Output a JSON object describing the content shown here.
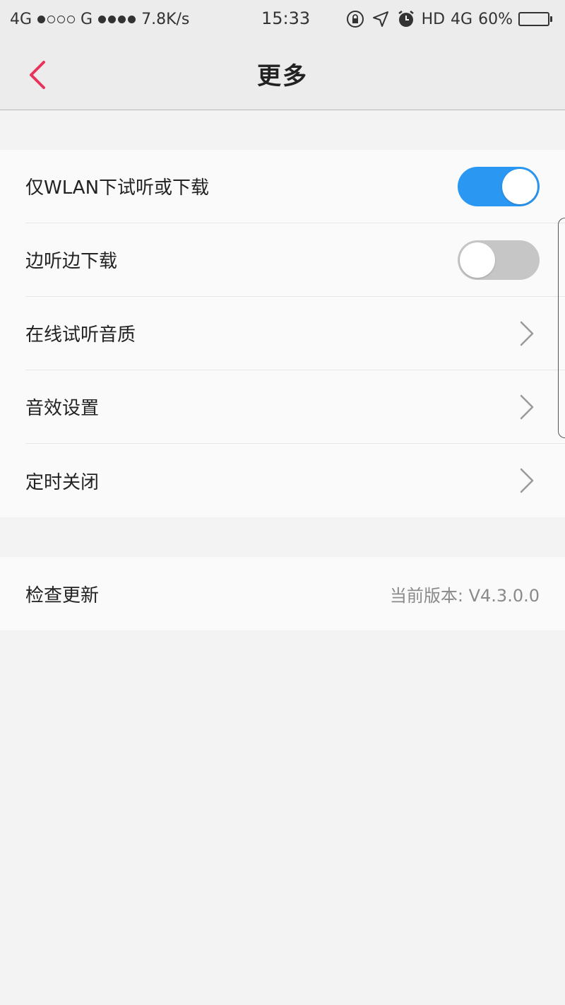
{
  "status_bar": {
    "network1": "4G",
    "network2": "G",
    "speed": "7.8K/s",
    "time": "15:33",
    "hd": "HD",
    "lte": "4G",
    "battery": "60%",
    "battery_level": 0.6,
    "icons": [
      "rotation-lock-icon",
      "location-icon",
      "alarm-icon"
    ]
  },
  "header": {
    "title": "更多",
    "back_icon": "chevron-left-icon",
    "accent": "#e8345a"
  },
  "settings": {
    "items": [
      {
        "label": "仅WLAN下试听或下载",
        "type": "toggle",
        "state": "on"
      },
      {
        "label": "边听边下载",
        "type": "toggle",
        "state": "off"
      },
      {
        "label": "在线试听音质",
        "type": "link"
      },
      {
        "label": "音效设置",
        "type": "link"
      },
      {
        "label": "定时关闭",
        "type": "link"
      }
    ]
  },
  "update": {
    "label": "检查更新",
    "version": "当前版本: V4.3.0.0"
  },
  "colors": {
    "toggle_on": "#2a97f3",
    "toggle_off": "#c6c6c6"
  }
}
